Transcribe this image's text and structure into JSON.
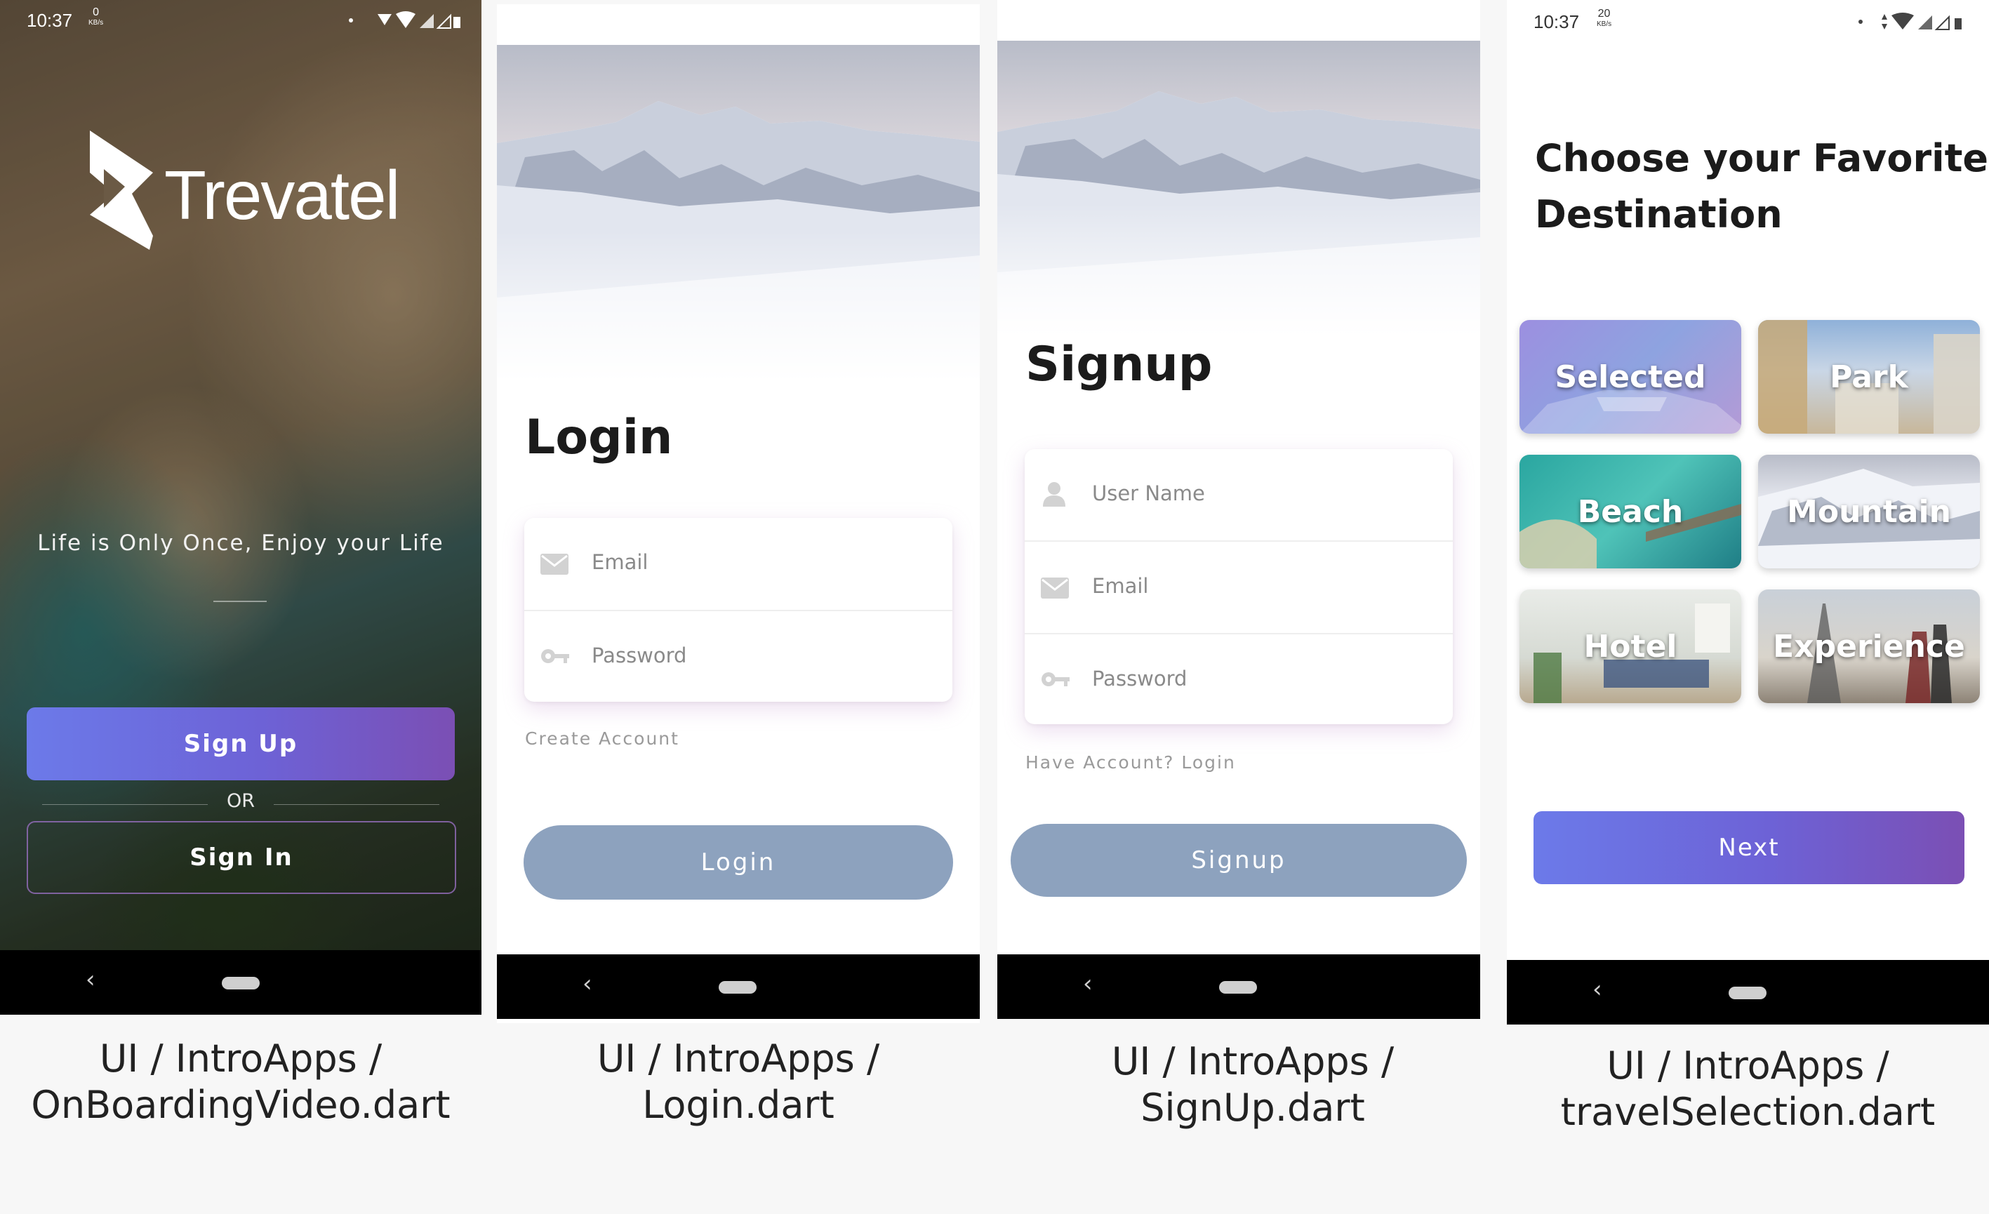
{
  "onboarding": {
    "status_time": "10:37",
    "status_speed": "0",
    "status_unit": "KB/s",
    "brand_name": "Trevatel",
    "tagline": "Life is Only Once, Enjoy your Life",
    "signup_label": "Sign Up",
    "or_label": "OR",
    "signin_label": "Sign In",
    "nav_back": "‹"
  },
  "login": {
    "title": "Login",
    "email_placeholder": "Email",
    "password_placeholder": "Password",
    "create_account_link": "Create Account",
    "login_button": "Login",
    "nav_back": "‹"
  },
  "signup": {
    "title": "Signup",
    "username_placeholder": "User Name",
    "email_placeholder": "Email",
    "password_placeholder": "Password",
    "have_account_link": "Have Account? Login",
    "signup_button": "Signup",
    "nav_back": "‹"
  },
  "selection": {
    "status_time": "10:37",
    "status_speed": "20",
    "status_unit": "KB/s",
    "title_line1": "Choose your Favorite",
    "title_line2": "Destination",
    "tiles": [
      "Selected",
      "Park",
      "Beach",
      "Mountain",
      "Hotel",
      "Experience"
    ],
    "next_button": "Next",
    "nav_back": "‹"
  },
  "captions": [
    {
      "line1": "UI / IntroApps /",
      "line2": "OnBoardingVideo.dart"
    },
    {
      "line1": "UI / IntroApps /",
      "line2": "Login.dart"
    },
    {
      "line1": "UI / IntroApps /",
      "line2": "SignUp.dart"
    },
    {
      "line1": "UI / IntroApps /",
      "line2": "travelSelection.dart"
    }
  ],
  "colors": {
    "accent_gradient_start": "#6c7ae9",
    "accent_gradient_end": "#7b4fb4",
    "button_grey": "#8da2be"
  }
}
